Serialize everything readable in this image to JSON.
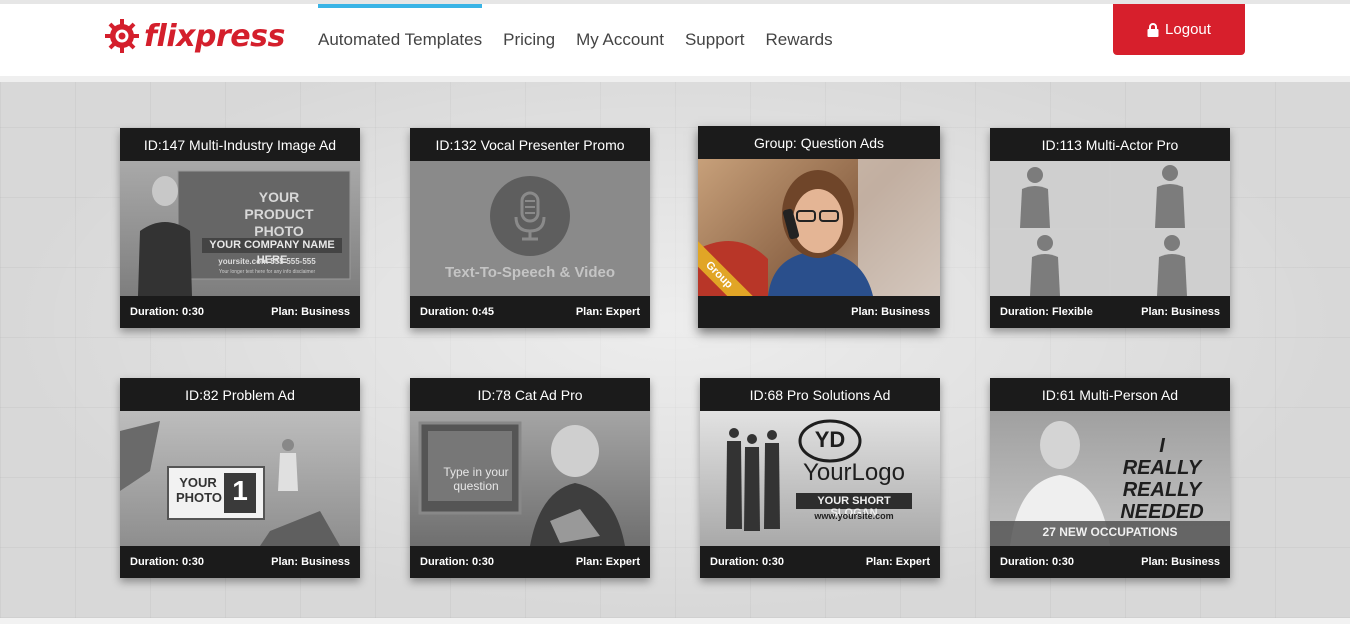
{
  "brand": {
    "name": "flixpress",
    "color": "#d41f2c"
  },
  "nav": {
    "items": [
      {
        "label": "Automated Templates",
        "active": true
      },
      {
        "label": "Pricing",
        "active": false
      },
      {
        "label": "My Account",
        "active": false
      },
      {
        "label": "Support",
        "active": false
      },
      {
        "label": "Rewards",
        "active": false
      }
    ],
    "active_color": "#3ab4e6"
  },
  "logout": {
    "label": "Logout",
    "icon": "lock-icon",
    "color": "#d71f2c"
  },
  "cards": [
    {
      "title": "ID:147 Multi-Industry Image Ad",
      "duration": "Duration: 0:30",
      "plan": "Plan: Business",
      "overlay": {
        "product": "YOUR PRODUCT PHOTO",
        "company": "YOUR COMPANY NAME HERE",
        "site": "yoursite.com 555-555-555",
        "disclaimer": "Your longer text here for any info disclaimer"
      }
    },
    {
      "title": "ID:132 Vocal Presenter Promo",
      "duration": "Duration: 0:45",
      "plan": "Plan: Expert",
      "overlay": {
        "caption": "Text-To-Speech & Video",
        "icon": "microphone-icon"
      }
    },
    {
      "title": "Group: Question Ads",
      "duration": "",
      "plan": "Plan: Business",
      "overlay": {
        "ribbon": "Group"
      }
    },
    {
      "title": "ID:113 Multi-Actor Pro",
      "duration": "Duration: Flexible",
      "plan": "Plan: Business"
    },
    {
      "title": "ID:82 Problem Ad",
      "duration": "Duration: 0:30",
      "plan": "Plan: Business",
      "overlay": {
        "photo": "YOUR PHOTO",
        "number": "1"
      }
    },
    {
      "title": "ID:78 Cat Ad Pro",
      "duration": "Duration: 0:30",
      "plan": "Plan: Expert",
      "overlay": {
        "question": "Type in your question"
      }
    },
    {
      "title": "ID:68 Pro Solutions Ad",
      "duration": "Duration: 0:30",
      "plan": "Plan: Expert",
      "overlay": {
        "logo_mark": "YD",
        "logo": "YourLogo",
        "slogan": "YOUR SHORT SLOGAN",
        "site": "www.yoursite.com"
      }
    },
    {
      "title": "ID:61 Multi-Person Ad",
      "duration": "Duration: 0:30",
      "plan": "Plan: Business",
      "overlay": {
        "headline": "I REALLY REALLY NEEDED",
        "banner": "27 NEW OCCUPATIONS"
      }
    }
  ]
}
